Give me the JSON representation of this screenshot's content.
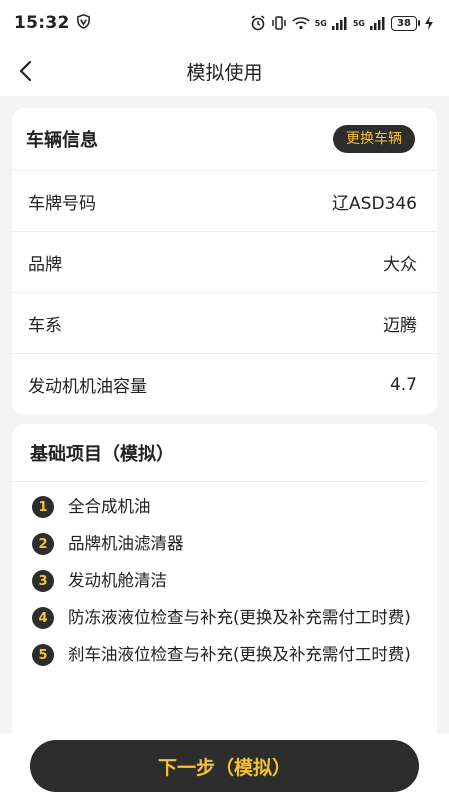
{
  "status_bar": {
    "time": "15:32",
    "net_label_1": "5G",
    "net_label_2": "5G",
    "battery": "38"
  },
  "header": {
    "title": "模拟使用"
  },
  "vehicle": {
    "title": "车辆信息",
    "change_label": "更换车辆",
    "rows": [
      {
        "label": "车牌号码",
        "value": "辽ASD346"
      },
      {
        "label": "品牌",
        "value": "大众"
      },
      {
        "label": "车系",
        "value": "迈腾"
      },
      {
        "label": "发动机机油容量",
        "value": "4.7"
      }
    ]
  },
  "project": {
    "title": "基础项目（模拟）",
    "items": [
      {
        "num": "1",
        "text": "全合成机油"
      },
      {
        "num": "2",
        "text": "品牌机油滤清器"
      },
      {
        "num": "3",
        "text": "发动机舱清洁"
      },
      {
        "num": "4",
        "text": "防冻液液位检查与补充(更换及补充需付工时费)"
      },
      {
        "num": "5",
        "text": "刹车油液位检查与补充(更换及补充需付工时费)"
      }
    ]
  },
  "bottom": {
    "next_label": "下一步（模拟）"
  },
  "colors": {
    "accent": "#f5c231",
    "dark": "#2d2d2d"
  }
}
